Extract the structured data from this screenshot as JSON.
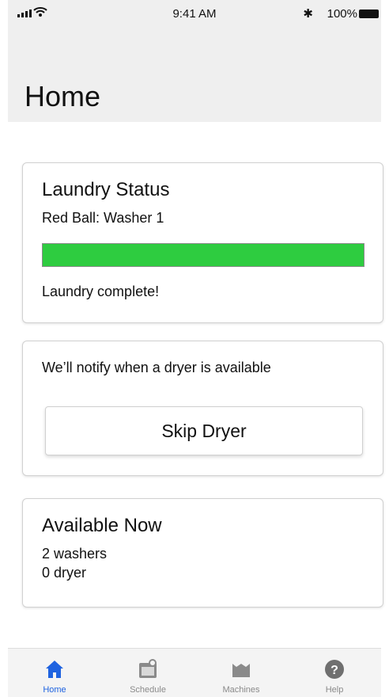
{
  "status_bar": {
    "time": "9:41 AM",
    "battery": "100%"
  },
  "header": {
    "title": "Home"
  },
  "laundry_status": {
    "title": "Laundry Status",
    "machine": "Red Ball: Washer 1",
    "progress_percent": 100,
    "progress_color": "#2ecc40",
    "message": "Laundry complete!"
  },
  "dryer_card": {
    "message": "We’ll notify when a dryer is available",
    "button_label": "Skip Dryer"
  },
  "available": {
    "title": "Available Now",
    "washers": "2 washers",
    "dryers": "0 dryer"
  },
  "tab_bar": {
    "active_color": "#1f63e0",
    "inactive_color": "#8a8a8a",
    "tabs": [
      {
        "label": "Home",
        "icon": "home-icon"
      },
      {
        "label": "Schedule",
        "icon": "schedule-icon"
      },
      {
        "label": "Machines",
        "icon": "machines-icon"
      },
      {
        "label": "Help",
        "icon": "help-icon"
      }
    ]
  }
}
